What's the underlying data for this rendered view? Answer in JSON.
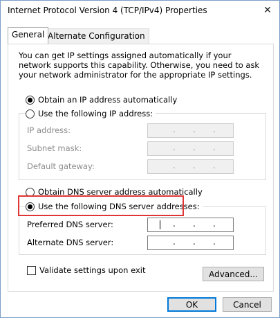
{
  "window": {
    "title": "Internet Protocol Version 4 (TCP/IPv4) Properties",
    "close_glyph": "✕"
  },
  "tabs": [
    {
      "label": "General"
    },
    {
      "label": "Alternate Configuration"
    }
  ],
  "description": "You can get IP settings assigned automatically if your network supports this capability. Otherwise, you need to ask your network administrator for the appropriate IP settings.",
  "ip_section": {
    "auto_label": "Obtain an IP address automatically",
    "manual_label": "Use the following IP address:",
    "fields": [
      {
        "label": "IP address:",
        "value": ". . ."
      },
      {
        "label": "Subnet mask:",
        "value": ". . ."
      },
      {
        "label": "Default gateway:",
        "value": ". . ."
      }
    ]
  },
  "dns_section": {
    "auto_label": "Obtain DNS server address automatically",
    "manual_label": "Use the following DNS server addresses:",
    "fields": [
      {
        "label": "Preferred DNS server:",
        "value": ". . ."
      },
      {
        "label": "Alternate DNS server:",
        "value": ". . ."
      }
    ]
  },
  "validate_label": "Validate settings upon exit",
  "buttons": {
    "advanced": "Advanced...",
    "ok": "OK",
    "cancel": "Cancel"
  },
  "colors": {
    "highlight": "#e03535",
    "default_button_border": "#0078d7"
  }
}
